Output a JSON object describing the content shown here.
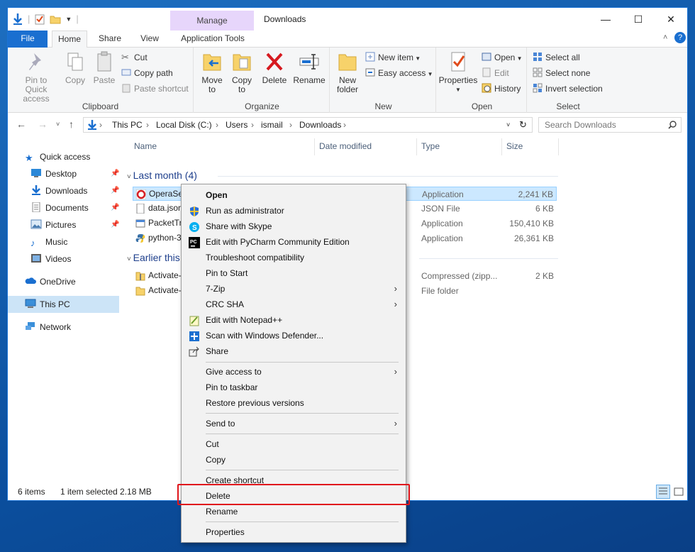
{
  "window": {
    "title": "Downloads",
    "contextual_tab": "Manage",
    "controls": {
      "minimize": "—",
      "maximize": "☐",
      "close": "✕"
    }
  },
  "ribbon_tabs": [
    "File",
    "Home",
    "Share",
    "View",
    "Application Tools"
  ],
  "ribbon": {
    "clipboard": {
      "label": "Clipboard",
      "pin": "Pin to Quick access",
      "copy": "Copy",
      "paste": "Paste",
      "cut": "Cut",
      "copy_path": "Copy path",
      "paste_shortcut": "Paste shortcut"
    },
    "organize": {
      "label": "Organize",
      "move_to": "Move to",
      "copy_to": "Copy to",
      "delete": "Delete",
      "rename": "Rename"
    },
    "new": {
      "label": "New",
      "new_folder": "New folder",
      "new_item": "New item",
      "easy_access": "Easy access"
    },
    "open": {
      "label": "Open",
      "properties": "Properties",
      "open": "Open",
      "edit": "Edit",
      "history": "History"
    },
    "select": {
      "label": "Select",
      "select_all": "Select all",
      "select_none": "Select none",
      "invert": "Invert selection"
    }
  },
  "address": {
    "breadcrumbs": [
      "This PC",
      "Local Disk (C:)",
      "Users",
      "ismail",
      "Downloads"
    ],
    "search_placeholder": "Search Downloads"
  },
  "nav": [
    {
      "label": "Quick access",
      "icon": "star-icon"
    },
    {
      "label": "Desktop",
      "icon": "desktop-icon"
    },
    {
      "label": "Downloads",
      "icon": "download-icon"
    },
    {
      "label": "Documents",
      "icon": "document-icon"
    },
    {
      "label": "Pictures",
      "icon": "pictures-icon"
    },
    {
      "label": "Music",
      "icon": "music-icon"
    },
    {
      "label": "Videos",
      "icon": "videos-icon"
    },
    {
      "label": "OneDrive",
      "icon": "cloud-icon"
    },
    {
      "label": "This PC",
      "icon": "computer-icon"
    },
    {
      "label": "Network",
      "icon": "network-icon"
    }
  ],
  "columns": [
    "Name",
    "Date modified",
    "Type",
    "Size"
  ],
  "groups": [
    {
      "title": "Last month (4)",
      "files": [
        {
          "name": "OperaSe",
          "type": "Application",
          "size": "2,241 KB",
          "icon": "opera-icon"
        },
        {
          "name": "data.json",
          "type": "JSON File",
          "size": "6 KB",
          "icon": "json-file-icon"
        },
        {
          "name": "PacketTr",
          "type": "Application",
          "size": "150,410 KB",
          "icon": "app-icon"
        },
        {
          "name": "python-3",
          "type": "Application",
          "size": "26,361 KB",
          "icon": "python-icon"
        }
      ]
    },
    {
      "title": "Earlier this",
      "files": [
        {
          "name": "Activate-",
          "type": "Compressed (zipp...",
          "size": "2 KB",
          "icon": "zip-icon"
        },
        {
          "name": "Activate-",
          "type": "File folder",
          "size": "",
          "icon": "folder-icon"
        }
      ]
    }
  ],
  "status": {
    "items": "6 items",
    "selected": "1 item selected  2.18 MB"
  },
  "context_menu": [
    {
      "label": "Open",
      "bold": true
    },
    {
      "label": "Run as administrator",
      "icon": "shield-icon"
    },
    {
      "label": "Share with Skype",
      "icon": "skype-icon"
    },
    {
      "label": "Edit with PyCharm Community Edition",
      "icon": "pycharm-icon"
    },
    {
      "label": "Troubleshoot compatibility"
    },
    {
      "label": "Pin to Start"
    },
    {
      "label": "7-Zip",
      "submenu": true
    },
    {
      "label": "CRC SHA",
      "submenu": true
    },
    {
      "label": "Edit with Notepad++",
      "icon": "notepadpp-icon"
    },
    {
      "label": "Scan with Windows Defender...",
      "icon": "defender-icon"
    },
    {
      "label": "Share",
      "icon": "share-icon"
    },
    {
      "separator": true
    },
    {
      "label": "Give access to",
      "submenu": true
    },
    {
      "label": "Pin to taskbar"
    },
    {
      "label": "Restore previous versions"
    },
    {
      "separator": true
    },
    {
      "label": "Send to",
      "submenu": true
    },
    {
      "separator": true
    },
    {
      "label": "Cut"
    },
    {
      "label": "Copy"
    },
    {
      "separator": true
    },
    {
      "label": "Create shortcut"
    },
    {
      "label": "Delete"
    },
    {
      "label": "Rename"
    },
    {
      "separator": true
    },
    {
      "label": "Properties"
    }
  ],
  "colors": {
    "accent": "#1a6fd0",
    "highlight": "#e0161c",
    "selection": "#cce8ff"
  }
}
